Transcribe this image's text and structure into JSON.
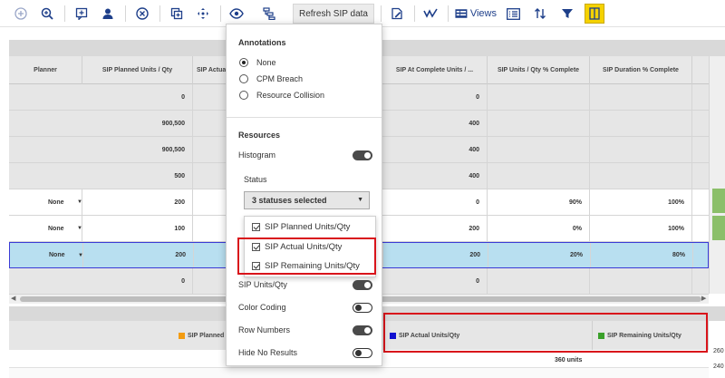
{
  "toolbar": {
    "refresh_label": "Refresh SIP data",
    "views_label": "Views",
    "accent_color": "#1e3f8a",
    "active_color": "#f5d200"
  },
  "grid": {
    "headers": [
      "Planner",
      "SIP Planned Units / Qty",
      "SIP Actual",
      "SIP At Complete Units / ...",
      "SIP Units / Qty % Complete",
      "SIP Duration % Complete"
    ],
    "rows": [
      {
        "planner": "",
        "planned": "0",
        "atcomplete": "0",
        "pct_units": "",
        "pct_duration": ""
      },
      {
        "planner": "",
        "planned": "900,500",
        "atcomplete": "400",
        "pct_units": "",
        "pct_duration": ""
      },
      {
        "planner": "",
        "planned": "900,500",
        "atcomplete": "400",
        "pct_units": "",
        "pct_duration": ""
      },
      {
        "planner": "",
        "planned": "500",
        "atcomplete": "400",
        "pct_units": "",
        "pct_duration": ""
      },
      {
        "planner": "None",
        "planned": "200",
        "atcomplete": "0",
        "pct_units": "90%",
        "pct_duration": "100%"
      },
      {
        "planner": "None",
        "planned": "100",
        "atcomplete": "200",
        "pct_units": "0%",
        "pct_duration": "100%"
      },
      {
        "planner": "None",
        "planned": "200",
        "atcomplete": "200",
        "pct_units": "20%",
        "pct_duration": "80%"
      },
      {
        "planner": "",
        "planned": "0",
        "atcomplete": "0",
        "pct_units": "",
        "pct_duration": ""
      }
    ]
  },
  "histogram": {
    "legend_planned": "SIP Planned U",
    "legend_actual": "SIP Actual Units/Qty",
    "legend_remaining": "SIP Remaining Units/Qty",
    "units_value": "360 units",
    "side_value_1": "260",
    "side_value_2": "240",
    "colors": {
      "planned": "#f39c12",
      "actual": "#1010d0",
      "remaining": "#3aa02a"
    }
  },
  "popup": {
    "annotations_title": "Annotations",
    "radio_options": [
      "None",
      "CPM Breach",
      "Resource Collision"
    ],
    "selected_radio": "None",
    "resources_title": "Resources",
    "histogram_label": "Histogram",
    "status_label": "Status",
    "status_select": "3 statuses selected",
    "status_options": [
      "SIP Planned Units/Qty",
      "SIP Actual Units/Qty",
      "SIP Remaining Units/Qty"
    ],
    "toggles": [
      {
        "label": "SIP Units/Qty",
        "on": true
      },
      {
        "label": "Color Coding",
        "on": false
      },
      {
        "label": "Row Numbers",
        "on": true
      },
      {
        "label": "Hide No Results",
        "on": false
      }
    ]
  }
}
